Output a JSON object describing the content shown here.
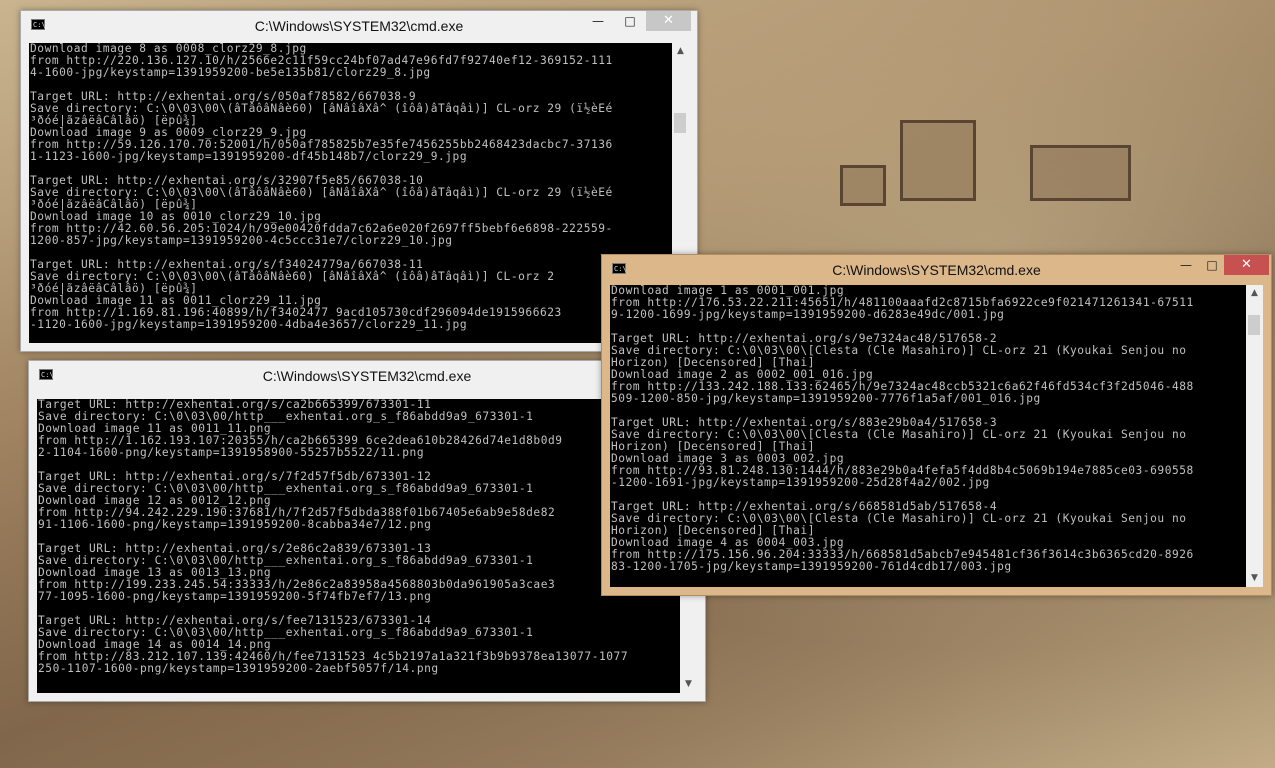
{
  "windows": [
    {
      "title": "C:\\Windows\\SYSTEM32\\cmd.exe",
      "lines": [
        "Download image 8 as 0008_clorz29_8.jpg",
        "from http://220.136.127.10/h/2566e2c11f59cc24bf07ad47e96fd7f92740ef12-369152-111",
        "4-1600-jpg/keystamp=1391959200-be5e135b81/clorz29_8.jpg",
        "",
        "Target URL: http://exhentai.org/s/050af78582/667038-9",
        "Save directory: C:\\0\\03\\00\\(âTâôâNâè60) [âNâîâXâ^ (îôâ)âTâqâì)] CL-orz 29 (ï½èEé",
        "³ðóé|ãzâëâCâlâö) [ëpû¾]",
        "Download image 9 as 0009_clorz29_9.jpg",
        "from http://59.126.170.70:52001/h/050af785825b7e35fe7456255bb2468423dacbc7-37136",
        "1-1123-1600-jpg/keystamp=1391959200-df45b148b7/clorz29_9.jpg",
        "",
        "Target URL: http://exhentai.org/s/32907f5e85/667038-10",
        "Save directory: C:\\0\\03\\00\\(âTâôâNâè60) [âNâîâXâ^ (îôâ)âTâqâì)] CL-orz 29 (ï½èEé",
        "³ðóé|ãzâëâCâlâö) [ëpû¾]",
        "Download image 10 as 0010_clorz29_10.jpg",
        "from http://42.60.56.205:1024/h/99e00420fdda7c62a6e020f2697ff5bebf6e6898-222559-",
        "1200-857-jpg/keystamp=1391959200-4c5ccc31e7/clorz29_10.jpg",
        "",
        "Target URL: http://exhentai.org/s/f34024779a/667038-11",
        "Save directory: C:\\0\\03\\00\\(âTâôâNâè60) [âNâîâXâ^ (îôâ)âTâqâì)] CL-orz 2",
        "³ðóé|ãzâëâCâlâö) [ëpû¾]",
        "Download image 11 as 0011_clorz29_11.jpg",
        "from http://1.169.81.196:40899/h/f3402477 9acd105730cdf296094de1915966623",
        "-1120-1600-jpg/keystamp=1391959200-4dba4e3657/clorz29_11.jpg"
      ],
      "controls": {
        "minimize": "—",
        "maximize": "□",
        "close": "✕"
      },
      "scroll": {
        "up": "▲",
        "down": "▼"
      }
    },
    {
      "title": "C:\\Windows\\SYSTEM32\\cmd.exe",
      "lines": [
        "Target URL: http://exhentai.org/s/ca2b665399/673301-11",
        "Save directory: C:\\0\\03\\00/http___exhentai.org_s_f86abdd9a9_673301-1",
        "Download image 11 as 0011_11.png",
        "from http://1.162.193.107:20355/h/ca2b665399 6ce2dea610b28426d74e1d8b0d9",
        "2-1104-1600-png/keystamp=1391958900-55257b5522/11.png",
        "",
        "Target URL: http://exhentai.org/s/7f2d57f5db/673301-12",
        "Save directory: C:\\0\\03\\00/http___exhentai.org_s_f86abdd9a9_673301-1",
        "Download image 12 as 0012_12.png",
        "from http://94.242.229.190:37681/h/7f2d57f5dbda388f01b67405e6ab9e58de82",
        "91-1106-1600-png/keystamp=1391959200-8cabba34e7/12.png",
        "",
        "Target URL: http://exhentai.org/s/2e86c2a839/673301-13",
        "Save directory: C:\\0\\03\\00/http___exhentai.org_s_f86abdd9a9_673301-1",
        "Download image 13 as 0013_13.png",
        "from http://199.233.245.54:33333/h/2e86c2a83958a4568803b0da961905a3cae3",
        "77-1095-1600-png/keystamp=1391959200-5f74fb7ef7/13.png",
        "",
        "Target URL: http://exhentai.org/s/fee7131523/673301-14",
        "Save directory: C:\\0\\03\\00/http___exhentai.org_s_f86abdd9a9_673301-1",
        "Download image 14 as 0014_14.png",
        "from http://83.212.107.139:42460/h/fee7131523 4c5b2197a1a321f3b9b9378ea13077-1077",
        "250-1107-1600-png/keystamp=1391959200-2aebf5057f/14.png"
      ],
      "controls": {
        "minimize": "—",
        "maximize": "□",
        "close": "✕"
      },
      "scroll": {
        "up": "▲",
        "down": "▼"
      }
    },
    {
      "title": "C:\\Windows\\SYSTEM32\\cmd.exe",
      "lines": [
        "Download image 1 as 0001_001.jpg",
        "from http://176.53.22.211:45651/h/481100aaafd2c8715bfa6922ce9f021471261341-67511",
        "9-1200-1699-jpg/keystamp=1391959200-d6283e49dc/001.jpg",
        "",
        "Target URL: http://exhentai.org/s/9e7324ac48/517658-2",
        "Save directory: C:\\0\\03\\00\\[Clesta (Cle Masahiro)] CL-orz 21 (Kyoukai Senjou no",
        "Horizon) [Decensored] [Thai]",
        "Download image 2 as 0002_001_016.jpg",
        "from http://133.242.188.133:62465/h/9e7324ac48ccb5321c6a62f46fd534cf3f2d5046-488",
        "509-1200-850-jpg/keystamp=1391959200-7776f1a5af/001_016.jpg",
        "",
        "Target URL: http://exhentai.org/s/883e29b0a4/517658-3",
        "Save directory: C:\\0\\03\\00\\[Clesta (Cle Masahiro)] CL-orz 21 (Kyoukai Senjou no",
        "Horizon) [Decensored] [Thai]",
        "Download image 3 as 0003_002.jpg",
        "from http://93.81.248.130:1444/h/883e29b0a4fefa5f4dd8b4c5069b194e7885ce03-690558",
        "-1200-1691-jpg/keystamp=1391959200-25d28f4a2/002.jpg",
        "",
        "Target URL: http://exhentai.org/s/668581d5ab/517658-4",
        "Save directory: C:\\0\\03\\00\\[Clesta (Cle Masahiro)] CL-orz 21 (Kyoukai Senjou no",
        "Horizon) [Decensored] [Thai]",
        "Download image 4 as 0004_003.jpg",
        "from http://175.156.96.204:33333/h/668581d5abcb7e945481cf36f3614c3b6365cd20-8926",
        "83-1200-1705-jpg/keystamp=1391959200-761d4cdb17/003.jpg"
      ],
      "controls": {
        "minimize": "—",
        "maximize": "□",
        "close": "✕"
      },
      "scroll": {
        "up": "▲",
        "down": "▼"
      }
    }
  ]
}
